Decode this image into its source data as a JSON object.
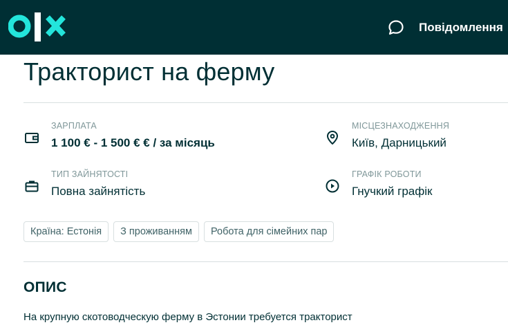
{
  "header": {
    "logo_text": "olx",
    "messages_label": "Повідомлення"
  },
  "listing": {
    "title": "Тракторист на ферму",
    "params": {
      "salary": {
        "label": "Зарплата",
        "value": "1 100 € - 1 500 € € / за місяць",
        "icon": "wallet-icon"
      },
      "location": {
        "label": "Місцезнаходження",
        "value": "Київ, Дарницький",
        "icon": "location-pin-icon"
      },
      "employment_type": {
        "label": "Тип зайнятості",
        "value": "Повна зайнятість",
        "icon": "briefcase-icon"
      },
      "schedule": {
        "label": "Графік роботи",
        "value": "Гнучкий графік",
        "icon": "clock-play-icon"
      }
    },
    "tags": [
      "Країна: Естонія",
      "З проживанням",
      "Робота для сімейних пар"
    ],
    "description_title": "ОПИС",
    "description": "На крупную скотоводческую ферму в Эстонии требуется тракторист"
  },
  "colors": {
    "header_bg": "#002f34",
    "brand_teal": "#23e5db",
    "text": "#002f34",
    "muted": "#7f9799"
  }
}
